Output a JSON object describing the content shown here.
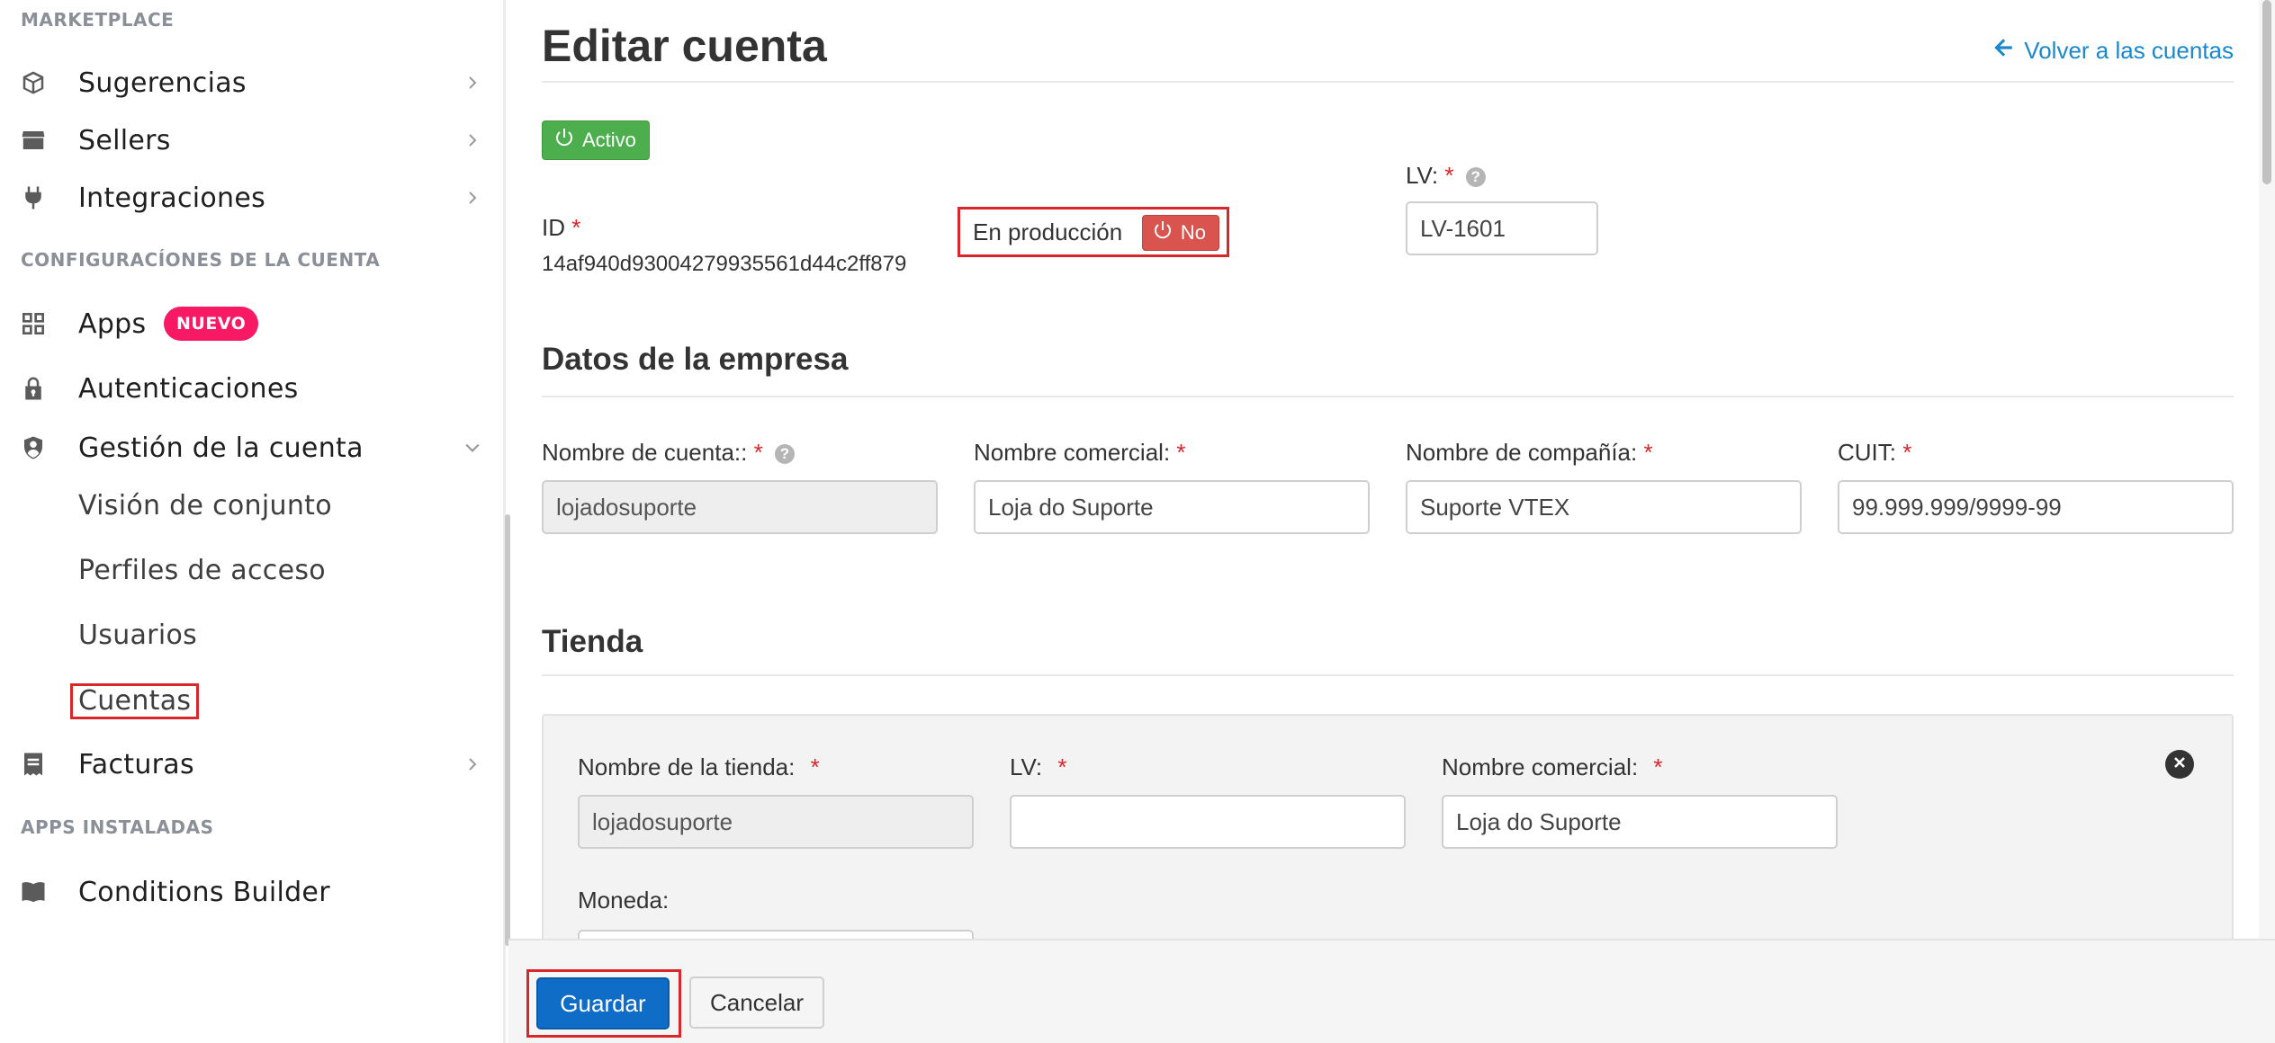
{
  "sidebar": {
    "sections": {
      "marketplace": "MARKETPLACE",
      "account_settings": "CONFIGURACÍONES DE LA CUENTA",
      "installed_apps": "APPS INSTALADAS"
    },
    "items": {
      "sugerencias": "Sugerencias",
      "sellers": "Sellers",
      "integraciones": "Integraciones",
      "apps": "Apps",
      "apps_badge": "NUEVO",
      "autenticaciones": "Autenticaciones",
      "gestion": "Gestión de la cuenta",
      "facturas": "Facturas",
      "conditions_builder": "Conditions Builder"
    },
    "sub_items": {
      "vision": "Visión de conjunto",
      "perfiles": "Perfiles de acceso",
      "usuarios": "Usuarios",
      "cuentas": "Cuentas"
    }
  },
  "header": {
    "title": "Editar cuenta",
    "back_link": "Volver a las cuentas"
  },
  "status": {
    "active_label": "Activo",
    "id_label": "ID",
    "id_value": "14af940d93004279935561d44c2ff879",
    "production_label": "En producción",
    "production_toggle": "No",
    "lv_label": "LV:",
    "lv_value": "LV-1601"
  },
  "company": {
    "section_title": "Datos de la empresa",
    "account_name_label": "Nombre de cuenta::",
    "account_name_value": "lojadosuporte",
    "trade_name_label": "Nombre comercial:",
    "trade_name_value": "Loja do Suporte",
    "company_name_label": "Nombre de compañía:",
    "company_name_value": "Suporte VTEX",
    "cuit_label": "CUIT:",
    "cuit_value": "99.999.999/9999-99"
  },
  "store": {
    "section_title": "Tienda",
    "store_name_label": "Nombre de la tienda:",
    "store_name_value": "lojadosuporte",
    "lv_label": "LV:",
    "lv_value": "",
    "trade_name_label": "Nombre comercial:",
    "trade_name_value": "Loja do Suporte",
    "currency_label": "Moneda:"
  },
  "footer": {
    "save": "Guardar",
    "cancel": "Cancelar"
  },
  "colors": {
    "accent_blue": "#0f6cc7",
    "link_blue": "#1b87cc",
    "active_green": "#4cae4c",
    "danger_red": "#d9534f",
    "badge_pink": "#f71963",
    "highlight_red": "#d9262b"
  }
}
